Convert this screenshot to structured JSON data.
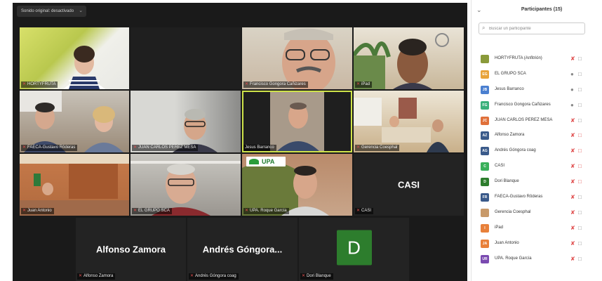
{
  "toolbar": {
    "audio_label": "Sonido original: desactivado",
    "chevron": "chevron-down-icon"
  },
  "tiles": [
    {
      "name": "HORTYFRUTA"
    },
    {
      "name": ""
    },
    {
      "name": "Francisco Gongora Cañizares"
    },
    {
      "name": "iPad"
    },
    {
      "name": "FAECA-Gustavo Rôderas"
    },
    {
      "name": "JUAN CARLOS PEREZ MESA"
    },
    {
      "name": "Jesus Barranco"
    },
    {
      "name": "Gerencia Coesphal"
    },
    {
      "name": "Juan Antonio"
    },
    {
      "name": "EL GRUPO SCA"
    },
    {
      "name": "UPA. Roque García",
      "logo": "UPA"
    },
    {
      "name": "CASI",
      "big": "CASI"
    },
    {
      "name": "Alfonso Zamora",
      "big": "Alfonso Zamora"
    },
    {
      "name": "Andrés Góngora coag",
      "big": "Andrés Góngora..."
    },
    {
      "name": "Dori Blanque",
      "avatar": "D"
    }
  ],
  "panel": {
    "title": "Participantes (15)",
    "search_placeholder": "Buscar un participante",
    "participants": [
      {
        "initials": "",
        "name": "HORTYFRUTA (Anfitrión)",
        "color": "#8a9a3a",
        "mic": "muted",
        "cam": "on"
      },
      {
        "initials": "EG",
        "name": "EL GRUPO SCA",
        "color": "#e8a33a",
        "mic": "on",
        "cam": "on"
      },
      {
        "initials": "JB",
        "name": "Jesus Barranco",
        "color": "#4a7fd0",
        "mic": "on",
        "cam": "on"
      },
      {
        "initials": "FG",
        "name": "Francisco Gongora Cañizares",
        "color": "#3ab07a",
        "mic": "on",
        "cam": "on"
      },
      {
        "initials": "JC",
        "name": "JUAN CARLOS PEREZ MESA",
        "color": "#e0703a",
        "mic": "muted",
        "cam": "on"
      },
      {
        "initials": "AZ",
        "name": "Alfonso Zamora",
        "color": "#3a5a8a",
        "mic": "muted",
        "cam": "off"
      },
      {
        "initials": "AG",
        "name": "Andrés Góngora coag",
        "color": "#3a5a8a",
        "mic": "muted",
        "cam": "off"
      },
      {
        "initials": "C",
        "name": "CASI",
        "color": "#3ab05a",
        "mic": "muted",
        "cam": "off"
      },
      {
        "initials": "D",
        "name": "Dori Blanque",
        "color": "#2d7d2d",
        "mic": "muted",
        "cam": "off"
      },
      {
        "initials": "FR",
        "name": "FAECA-Gustavo Rôderas",
        "color": "#3a5a8a",
        "mic": "muted",
        "cam": "on"
      },
      {
        "initials": "",
        "name": "Gerencia Coesphal",
        "color": "#c89a6a",
        "mic": "muted",
        "cam": "on"
      },
      {
        "initials": "I",
        "name": "iPad",
        "color": "#e8803a",
        "mic": "muted",
        "cam": "on"
      },
      {
        "initials": "JA",
        "name": "Juan Antonio",
        "color": "#e8803a",
        "mic": "muted",
        "cam": "on"
      },
      {
        "initials": "UR",
        "name": "UPA. Roque García",
        "color": "#7a4ab0",
        "mic": "muted",
        "cam": "on"
      }
    ]
  }
}
